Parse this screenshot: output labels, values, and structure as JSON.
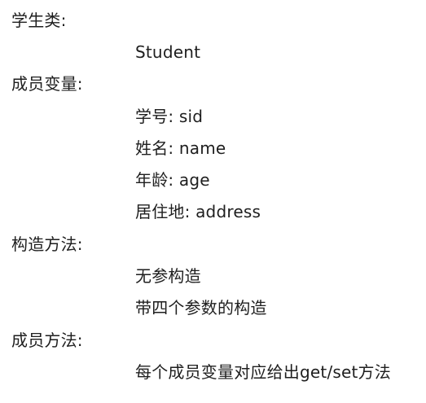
{
  "sections": [
    {
      "heading": "学生类:",
      "items": [
        "Student"
      ]
    },
    {
      "heading": "成员变量:",
      "items": [
        "学号: sid",
        "姓名: name",
        "年龄: age",
        "居住地: address"
      ]
    },
    {
      "heading": "构造方法:",
      "items": [
        "无参构造",
        "带四个参数的构造"
      ]
    },
    {
      "heading": "成员方法:",
      "items": [
        "每个成员变量对应给出get/set方法"
      ]
    }
  ],
  "colors": {
    "text": "#1e1e1e",
    "background": "#ffffff"
  }
}
